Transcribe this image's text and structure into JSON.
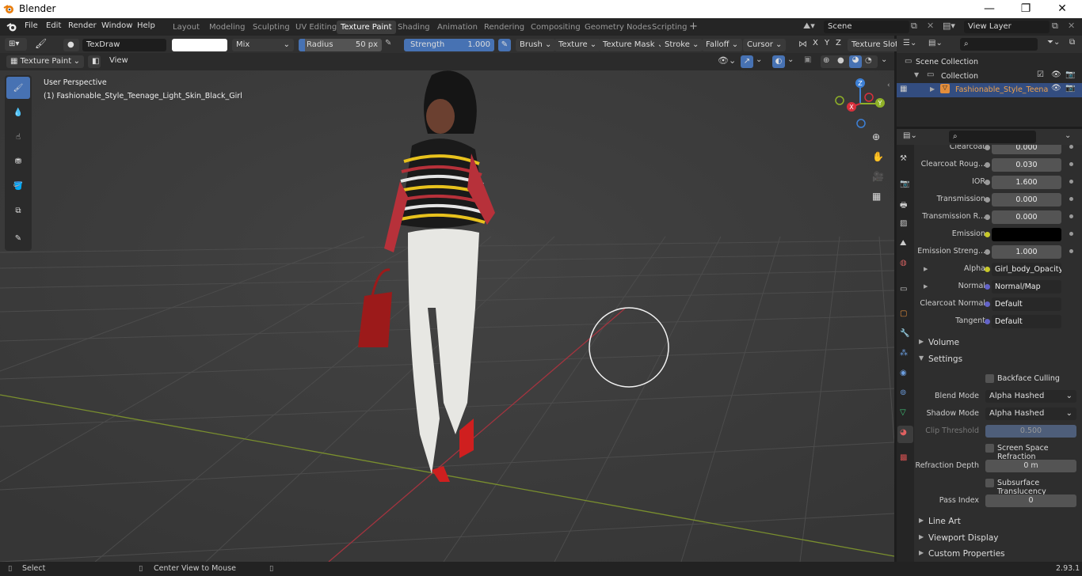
{
  "window": {
    "title": "Blender",
    "minimize": "—",
    "maximize": "❐",
    "close": "✕"
  },
  "menu": [
    "File",
    "Edit",
    "Render",
    "Window",
    "Help"
  ],
  "workspaces": [
    "Layout",
    "Modeling",
    "Sculpting",
    "UV Editing",
    "Texture Paint",
    "Shading",
    "Animation",
    "Rendering",
    "Compositing",
    "Geometry Nodes",
    "Scripting"
  ],
  "active_workspace": "Texture Paint",
  "scene": {
    "label": "Scene",
    "view_layer": "View Layer"
  },
  "tool_header": {
    "brush_name": "TexDraw",
    "blend": "Mix",
    "radius_label": "Radius",
    "radius_value": "50 px",
    "strength_label": "Strength",
    "strength_value": "1.000",
    "strength_fraction": 1.0,
    "menus": [
      "Brush",
      "Texture",
      "Texture Mask",
      "Stroke",
      "Falloff",
      "Cursor"
    ],
    "axes": [
      "X",
      "Y",
      "Z"
    ],
    "texture_slots": "Texture Slots"
  },
  "viewport_header": {
    "mode": "Texture Paint",
    "view": "View"
  },
  "viewport": {
    "perspective": "User Perspective",
    "object_info": "(1) Fashionable_Style_Teenage_Light_Skin_Black_Girl",
    "gizmo": {
      "x": "X",
      "y": "Y",
      "z": "Z"
    }
  },
  "outliner": {
    "scene_collection": "Scene Collection",
    "collection": "Collection",
    "object": "Fashionable_Style_Teena"
  },
  "properties": {
    "rows": [
      {
        "label": "Clearcoat",
        "value": "0.000",
        "dot": "#9a9a9a"
      },
      {
        "label": "Clearcoat Roug...",
        "value": "0.030",
        "dot": "#9a9a9a"
      },
      {
        "label": "IOR",
        "value": "1.600",
        "dot": "#9a9a9a"
      },
      {
        "label": "Transmission",
        "value": "0.000",
        "dot": "#9a9a9a"
      },
      {
        "label": "Transmission R...",
        "value": "0.000",
        "dot": "#9a9a9a"
      },
      {
        "label": "Emission",
        "value": "",
        "dot": "#c7c729"
      },
      {
        "label": "Emission Streng...",
        "value": "1.000",
        "dot": "#9a9a9a"
      },
      {
        "label": "Alpha",
        "value": "Girl_body_Opacity.p...",
        "dot": "#c7c729"
      },
      {
        "label": "Normal",
        "value": "Normal/Map",
        "dot": "#6363c7"
      },
      {
        "label": "Clearcoat Normal",
        "value": "Default",
        "dot": "#6363c7"
      },
      {
        "label": "Tangent",
        "value": "Default",
        "dot": "#6363c7"
      }
    ],
    "volume": "Volume",
    "settings": "Settings",
    "backface_culling": "Backface Culling",
    "blend_mode_label": "Blend Mode",
    "blend_mode": "Alpha Hashed",
    "shadow_mode_label": "Shadow Mode",
    "shadow_mode": "Alpha Hashed",
    "clip_threshold_label": "Clip Threshold",
    "clip_threshold": "0.500",
    "ssr": "Screen Space Refraction",
    "refraction_depth_label": "Refraction Depth",
    "refraction_depth": "0 m",
    "sss": "Subsurface Translucency",
    "pass_index_label": "Pass Index",
    "pass_index": "0",
    "line_art": "Line Art",
    "viewport_display": "Viewport Display",
    "custom_properties": "Custom Properties"
  },
  "status": {
    "select": "Select",
    "center": "Center View to Mouse",
    "version": "2.93.1"
  }
}
